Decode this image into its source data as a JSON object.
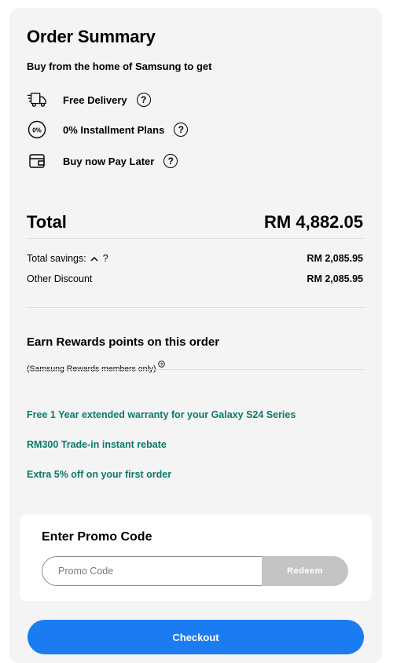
{
  "summary": {
    "title": "Order Summary",
    "subtitle": "Buy from the home of Samsung to get",
    "benefits": [
      {
        "label": "Free Delivery",
        "icon": "delivery-truck-icon",
        "help": "?"
      },
      {
        "label": "0% Installment Plans",
        "icon": "zero-percent-icon",
        "help": "?"
      },
      {
        "label": "Buy now Pay Later",
        "icon": "wallet-icon",
        "help": "?"
      }
    ]
  },
  "totals": {
    "total_label": "Total",
    "total_value": "RM 4,882.05",
    "savings_label": "Total savings:",
    "savings_caret": "^",
    "savings_help": "?",
    "savings_value": "RM 2,085.95",
    "discount_label": "Other Discount",
    "discount_value": "RM 2,085.95"
  },
  "rewards": {
    "title": "Earn Rewards points on this order",
    "note": "(Samsung Rewards members only)",
    "info_icon": "info-icon"
  },
  "promos": [
    "Free 1 Year extended warranty for your Galaxy S24 Series",
    "RM300 Trade-in instant rebate",
    "Extra 5% off on your first order"
  ],
  "promo_code": {
    "title": "Enter Promo Code",
    "placeholder": "Promo Code",
    "value": "",
    "redeem_label": "Redeem"
  },
  "checkout": {
    "label": "Checkout"
  },
  "colors": {
    "accent": "#1b7cf2",
    "promo_text": "#0a7a6a",
    "panel_bg": "#f4f4f4",
    "redeem_disabled": "#c4c4c4"
  }
}
